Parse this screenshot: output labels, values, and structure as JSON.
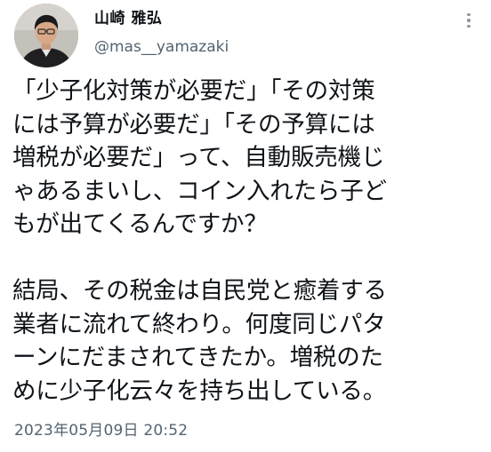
{
  "author": {
    "display_name": "山崎 雅弘",
    "handle": "@mas__yamazaki",
    "avatar_icon": "profile-photo"
  },
  "menu": {
    "icon": "more-vertical-icon"
  },
  "tweet": {
    "paragraph1": [
      "「少子化対策が必要だ」「その対策",
      "には予算が必要だ」「その予算には",
      "増税が必要だ」って、自動販売機じ",
      "ゃあるまいし、コイン入れたら子ど",
      "もが出てくるんですか？"
    ],
    "paragraph2": [
      "結局、その税金は自民党と癒着する",
      "業者に流れて終わり。何度同じパタ",
      "ーンにだまされてきたか。増税のた",
      "めに少子化云々を持ち出している。"
    ],
    "timestamp": "2023年05月09日 20:52"
  },
  "colors": {
    "text": "#0f1419",
    "secondary": "#536471",
    "icon": "#8b98a5",
    "background": "#ffffff"
  }
}
